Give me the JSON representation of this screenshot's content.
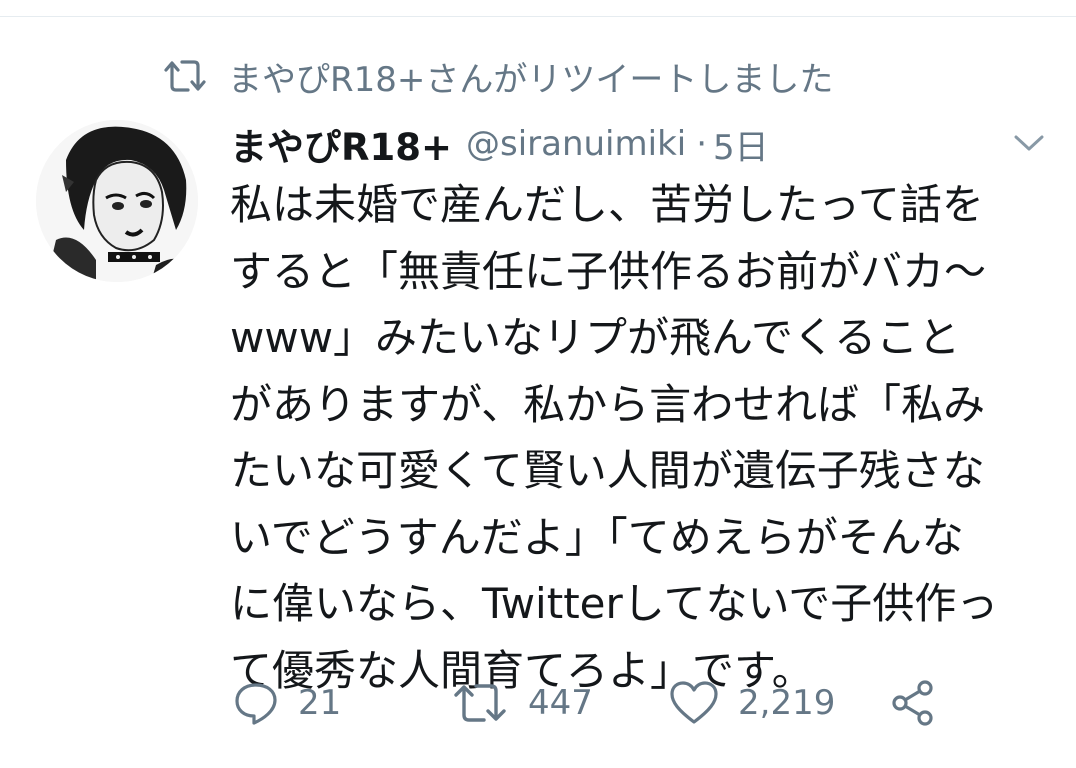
{
  "retweet_context": {
    "text": "まやぴR18+さんがリツイートしました",
    "icon": "retweet-icon"
  },
  "tweet": {
    "author": {
      "display_name": "まやぴR18+",
      "handle": "@siranuimiki",
      "avatar": "avatar-image"
    },
    "separator": "·",
    "time": "5日",
    "menu_icon": "chevron-down-icon",
    "lines": [
      "私は未婚で産んだし、苦労したって話を",
      "すると「無責任に子供作るお前がバカ～",
      "www」みたいなリプが飛んでくること",
      "がありますが、私から言わせれば「私み",
      "たいな可愛くて賢い人間が遺伝子残さな",
      "いでどうすんだよ」「てめえらがそんな",
      "に偉いなら、Twitterしてないで子供作っ",
      "て優秀な人間育てろよ」です。"
    ]
  },
  "actions": {
    "reply": {
      "icon": "reply-icon",
      "count": "21"
    },
    "retweet": {
      "icon": "retweet-icon",
      "count": "447"
    },
    "like": {
      "icon": "heart-icon",
      "count": "2,219"
    },
    "share": {
      "icon": "share-icon"
    }
  },
  "colors": {
    "text": "#14171a",
    "secondary": "#657786",
    "divider": "#e6ecf0"
  }
}
